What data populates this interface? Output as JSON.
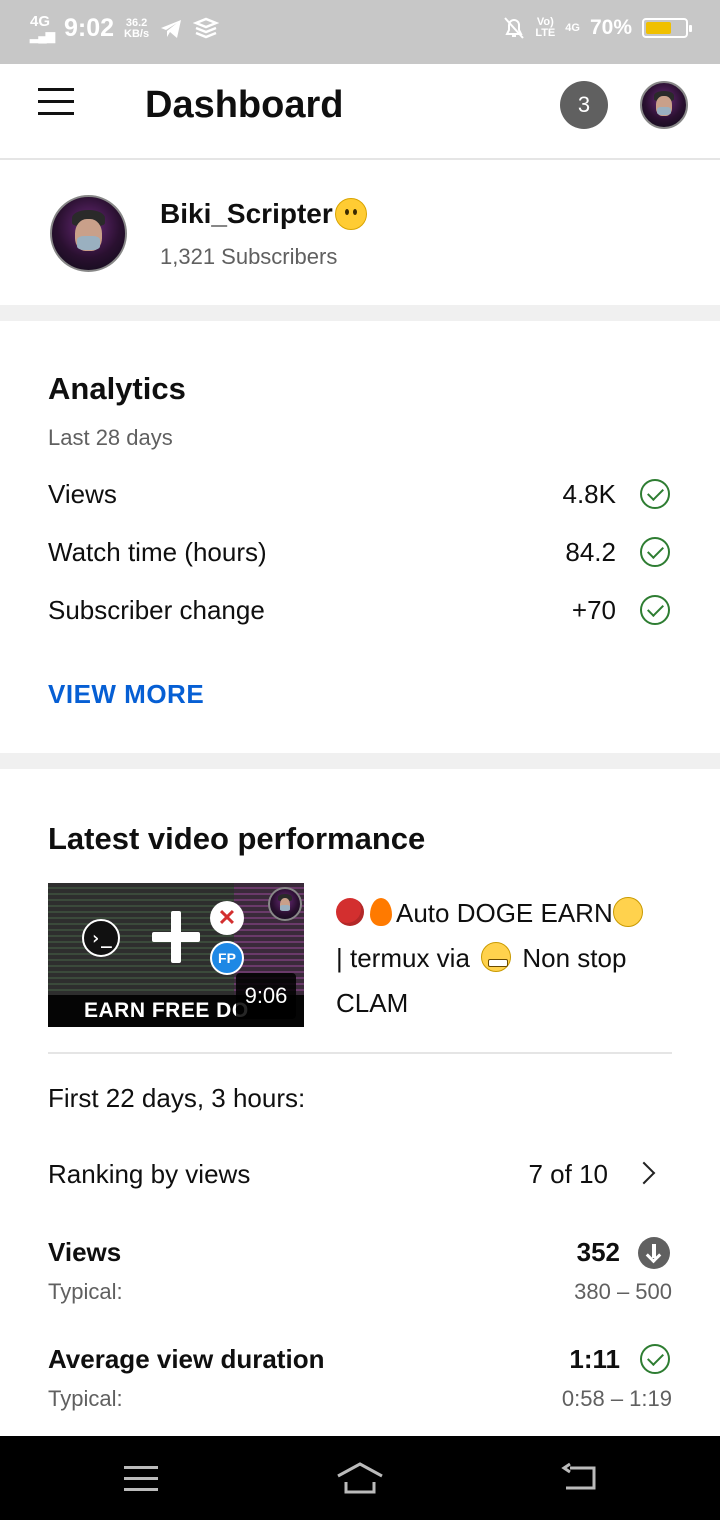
{
  "status_bar": {
    "network": "4G",
    "time": "9:02",
    "speed_value": "36.2",
    "speed_unit": "KB/s",
    "volte": "Vo)",
    "lte": "LTE",
    "network2": "4G",
    "battery_percent": "70%",
    "battery_level": 0.7,
    "battery_color": "#f0c000"
  },
  "appbar": {
    "title": "Dashboard",
    "notification_count": "3"
  },
  "channel": {
    "name": "Biki_Scripter",
    "subscribers": "1,321 Subscribers"
  },
  "analytics": {
    "title": "Analytics",
    "period": "Last 28 days",
    "metrics": [
      {
        "label": "Views",
        "value": "4.8K"
      },
      {
        "label": "Watch time (hours)",
        "value": "84.2"
      },
      {
        "label": "Subscriber change",
        "value": "+70"
      }
    ],
    "view_more": "VIEW MORE"
  },
  "latest": {
    "title": "Latest video performance",
    "thumbnail_text": "EARN FREE DO",
    "thumbnail_fp": "FP",
    "thumbnail_term": "›_",
    "duration": "9:06",
    "video_title_1": "Auto DOGE EARN",
    "video_title_2": "| termux via",
    "video_title_3": "Non stop CLAM",
    "period": "First 22 days, 3 hours:",
    "ranking_label": "Ranking by views",
    "ranking_value": "7 of 10",
    "stats": [
      {
        "label": "Views",
        "value": "352",
        "typical_label": "Typical:",
        "typical_range": "380 – 500"
      },
      {
        "label": "Average view duration",
        "value": "1:11",
        "typical_label": "Typical:",
        "typical_range": "0:58 – 1:19"
      }
    ]
  },
  "colors": {
    "accent_link": "#065fd4",
    "check_green": "#2e7d32",
    "badge_grey": "#606060"
  }
}
